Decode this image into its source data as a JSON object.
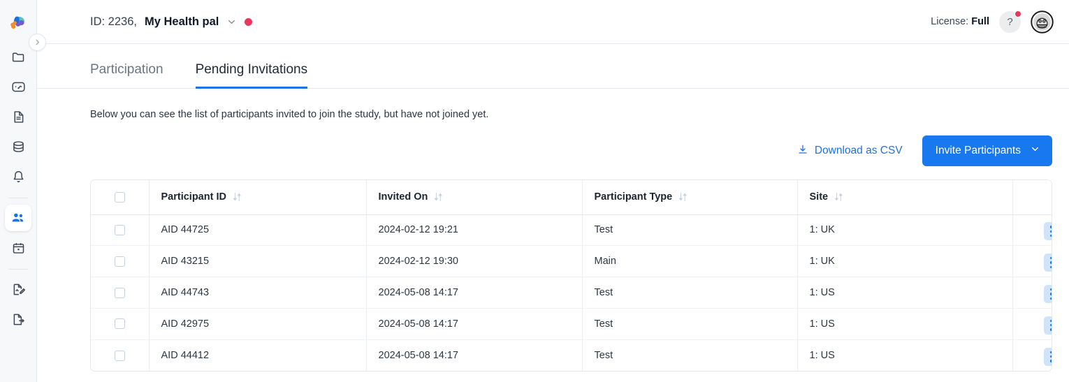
{
  "header": {
    "logo_icon": "brain-puzzle-logo",
    "study_id_label": "ID: 2236,",
    "study_name": "My Health pal",
    "dropdown_icon": "chevron-down-icon",
    "status_dot_color": "#e8365d",
    "license_label": "License:",
    "license_value": "Full",
    "help_label": "?",
    "avatar_alt": "user-avatar"
  },
  "sidebar": {
    "collapse_icon": "chevron-right-icon",
    "items": [
      {
        "name": "folder",
        "active": false
      },
      {
        "name": "dashboard-gauge",
        "active": false
      },
      {
        "name": "document",
        "active": false
      },
      {
        "name": "database",
        "active": false
      },
      {
        "name": "bell",
        "active": false
      },
      {
        "name": "people",
        "active": true
      },
      {
        "name": "calendar",
        "active": false
      },
      {
        "name": "document-edit",
        "active": false
      },
      {
        "name": "document-export",
        "active": false
      }
    ]
  },
  "tabs": [
    {
      "label": "Participation",
      "active": false
    },
    {
      "label": "Pending Invitations",
      "active": true
    }
  ],
  "main": {
    "description": "Below you can see the list of participants invited to join the study, but have not joined yet.",
    "download_csv_label": "Download as CSV",
    "download_icon": "download-icon",
    "invite_button_label": "Invite Participants",
    "invite_chevron_icon": "chevron-down-icon",
    "accent_color": "#1878f0",
    "link_color": "#1a73e8"
  },
  "table": {
    "columns": [
      {
        "key": "select",
        "label": ""
      },
      {
        "key": "participant_id",
        "label": "Participant ID",
        "sortable": true
      },
      {
        "key": "invited_on",
        "label": "Invited On",
        "sortable": true
      },
      {
        "key": "participant_type",
        "label": "Participant Type",
        "sortable": true
      },
      {
        "key": "site",
        "label": "Site",
        "sortable": true
      },
      {
        "key": "actions",
        "label": ""
      }
    ],
    "select_all_checked": false,
    "rows": [
      {
        "participant_id": "AID 44725",
        "invited_on": "2024-02-12 19:21",
        "participant_type": "Test",
        "site": "1: UK",
        "checked": false
      },
      {
        "participant_id": "AID 43215",
        "invited_on": "2024-02-12 19:30",
        "participant_type": "Main",
        "site": "1: UK",
        "checked": false
      },
      {
        "participant_id": "AID 44743",
        "invited_on": "2024-05-08 14:17",
        "participant_type": "Test",
        "site": "1: US",
        "checked": false
      },
      {
        "participant_id": "AID 42975",
        "invited_on": "2024-05-08 14:17",
        "participant_type": "Test",
        "site": "1: US",
        "checked": false
      },
      {
        "participant_id": "AID 44412",
        "invited_on": "2024-05-08 14:17",
        "participant_type": "Test",
        "site": "1: US",
        "checked": false
      }
    ],
    "row_menu_icon": "kebab-menu-icon"
  }
}
